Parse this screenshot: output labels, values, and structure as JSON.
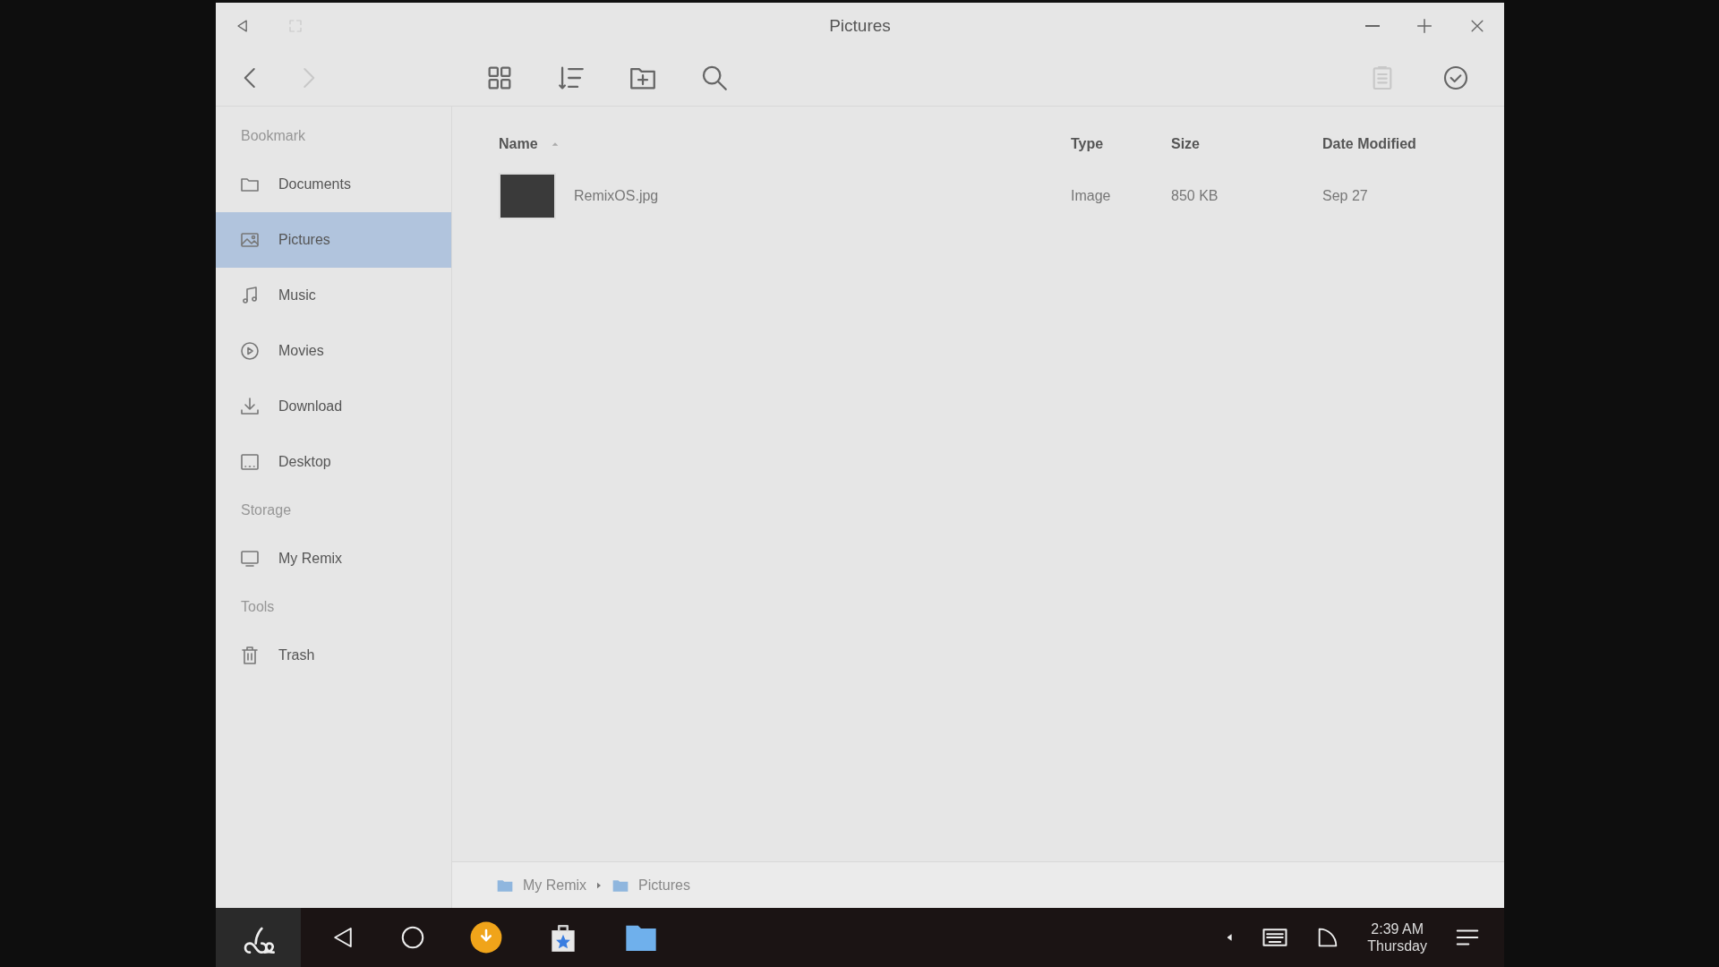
{
  "window": {
    "title": "Pictures"
  },
  "nav": [
    {
      "kind": "back",
      "disabled": false
    },
    {
      "kind": "forward",
      "disabled": true
    }
  ],
  "toolbar": [
    {
      "kind": "grid"
    },
    {
      "kind": "sort"
    },
    {
      "kind": "new-folder"
    },
    {
      "kind": "search"
    }
  ],
  "toolbar_right": [
    {
      "kind": "paste",
      "disabled": true
    },
    {
      "kind": "select",
      "disabled": false
    }
  ],
  "sidebar": [
    {
      "heading": "Bookmark",
      "items": [
        {
          "label": "Documents",
          "kind": "folder",
          "selected": false
        },
        {
          "label": "Pictures",
          "kind": "image",
          "selected": true
        },
        {
          "label": "Music",
          "kind": "music",
          "selected": false
        },
        {
          "label": "Movies",
          "kind": "movie",
          "selected": false
        },
        {
          "label": "Download",
          "kind": "download",
          "selected": false
        },
        {
          "label": "Desktop",
          "kind": "desktop",
          "selected": false
        }
      ]
    },
    {
      "heading": "Storage",
      "items": [
        {
          "label": "My Remix",
          "kind": "monitor",
          "selected": false
        }
      ]
    },
    {
      "heading": "Tools",
      "items": [
        {
          "label": "Trash",
          "kind": "trash",
          "selected": false
        }
      ]
    }
  ],
  "table": {
    "columns": [
      {
        "label": "Name",
        "sorted": true
      },
      {
        "label": "Type",
        "sorted": false
      },
      {
        "label": "Size",
        "sorted": false
      },
      {
        "label": "Date Modified",
        "sorted": false
      }
    ],
    "rows": [
      {
        "name": "RemixOS.jpg",
        "type": "Image",
        "size": "850 KB",
        "date": "Sep 27"
      }
    ]
  },
  "breadcrumb": [
    "My Remix",
    "Pictures"
  ],
  "taskbar": {
    "time": "2:39 AM",
    "day": "Thursday"
  }
}
